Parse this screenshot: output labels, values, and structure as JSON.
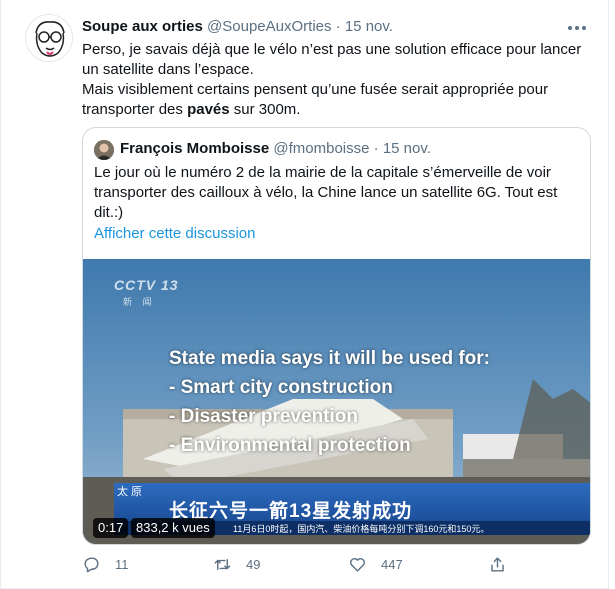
{
  "tweet": {
    "author_name": "Soupe aux orties",
    "author_handle": "@SoupeAuxOrties",
    "separator": "·",
    "date": "15 nov.",
    "text_line1": "Perso, je savais déjà que le vélo n’est pas une solution efficace pour lancer",
    "text_line2": "un satellite dans l’espace.",
    "text_line3": "Mais visiblement certains pensent qu’une fusée serait appropriée pour",
    "text_line4_prefix": "transporter des ",
    "text_line4_bold": "pavés",
    "text_line4_suffix": " sur 300m."
  },
  "quoted": {
    "author_name": "François Momboisse",
    "author_handle": "@fmomboisse",
    "separator": "·",
    "date": "15 nov.",
    "text_line1": "Le jour où le numéro 2 de la mairie de la capitale s’émerveille de voir",
    "text_line2": "transporter des cailloux à vélo, la Chine lance un satellite 6G. Tout est",
    "text_line3": "dit.:)",
    "show_thread": "Afficher cette discussion"
  },
  "video": {
    "channel_logo": "CCTV 13",
    "channel_sub": "新 闻",
    "overlay_line1": "State media says it will be used for:",
    "overlay_line2": "- Smart city construction",
    "overlay_line3": "- Disaster prevention",
    "overlay_line4": "- Environmental protection",
    "banner_tag": "太 原",
    "banner_main": "长征六号一箭13星发射成功",
    "ticker": "11月6日0时起，国内汽、柴油价格每吨分别下调160元和150元。",
    "duration": "0:17",
    "views": "833,2 k vues"
  },
  "actions": {
    "reply_count": "11",
    "retweet_count": "49",
    "like_count": "447"
  },
  "colors": {
    "link": "#1b95e0",
    "muted": "#5b7083",
    "border": "#cfd9de"
  }
}
